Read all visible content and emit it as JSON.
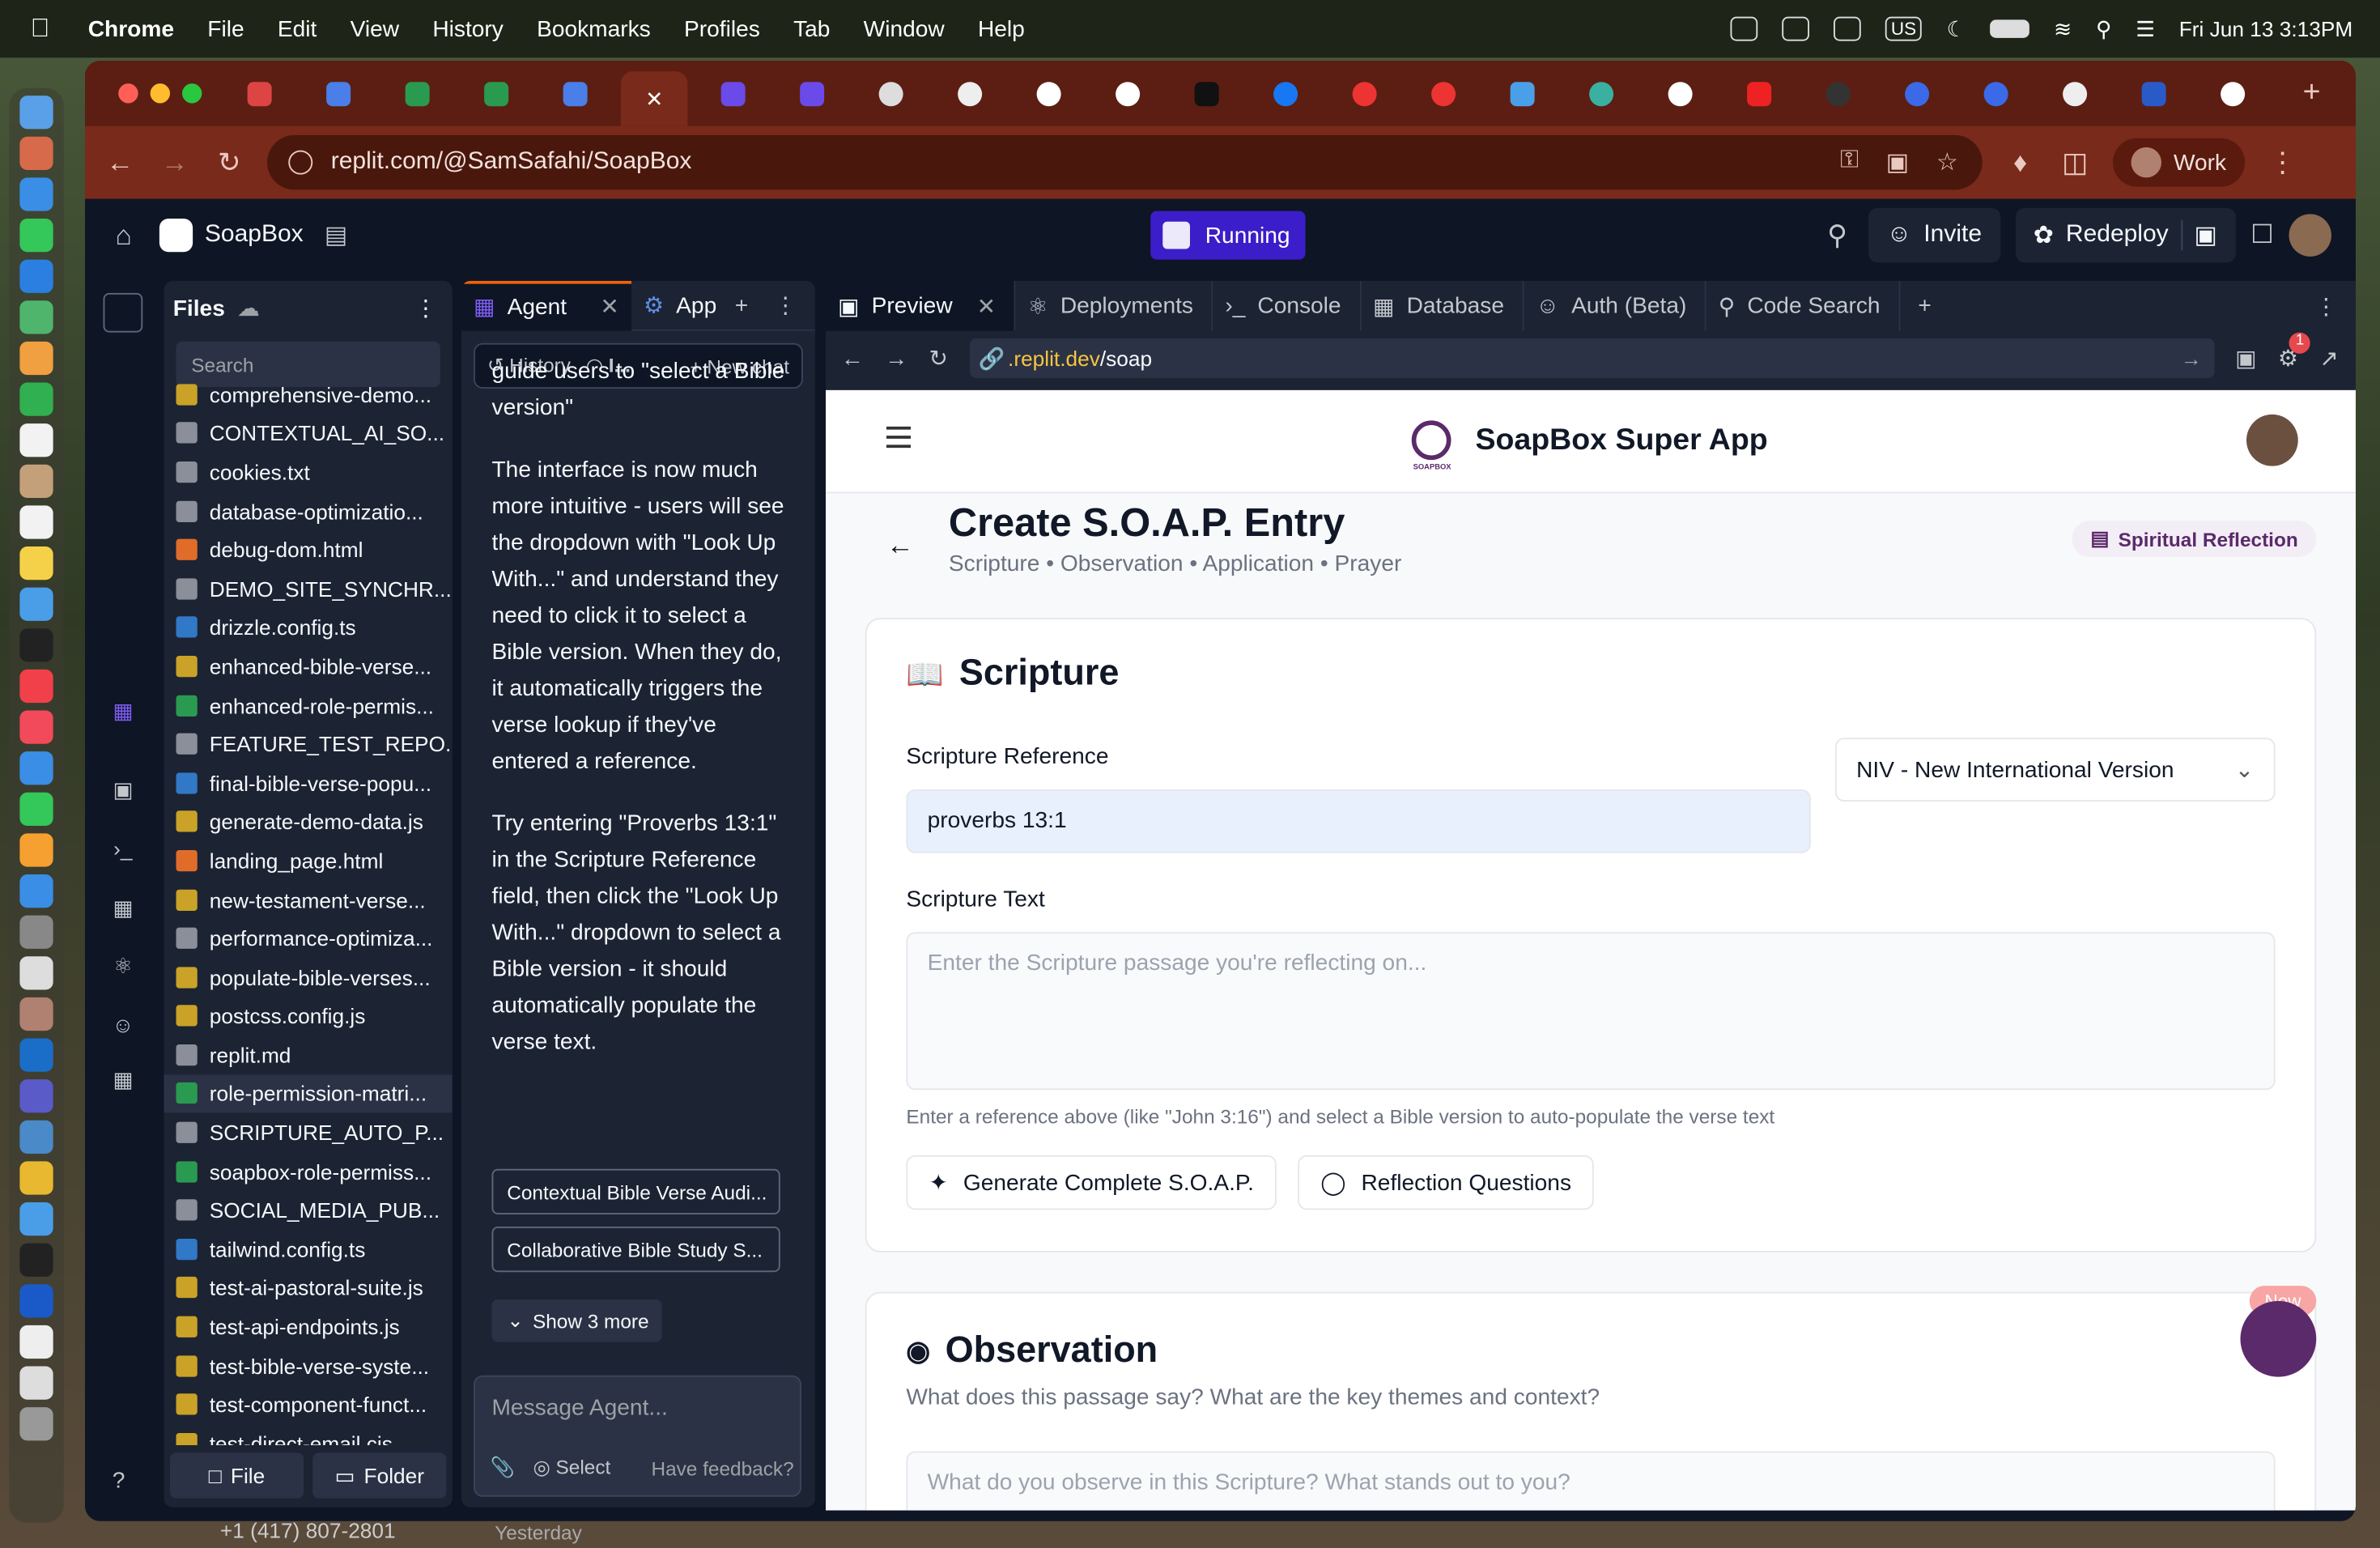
{
  "menubar": {
    "app": "Chrome",
    "items": [
      "File",
      "Edit",
      "View",
      "History",
      "Bookmarks",
      "Profiles",
      "Tab",
      "Window",
      "Help"
    ],
    "input_badge": "US",
    "datetime": "Fri Jun 13  3:13PM"
  },
  "browser": {
    "url": "replit.com/@SamSafahi/SoapBox",
    "profile": "Work"
  },
  "replit": {
    "app_name": "SoapBox",
    "status": "Running",
    "invite": "Invite",
    "redeploy": "Redeploy",
    "help": "?"
  },
  "files": {
    "title": "Files",
    "search_placeholder": "Search",
    "items": [
      {
        "name": "comprehensive-demo...",
        "type": "js"
      },
      {
        "name": "CONTEXTUAL_AI_SO...",
        "type": "md"
      },
      {
        "name": "cookies.txt",
        "type": "txt"
      },
      {
        "name": "database-optimizatio...",
        "type": "db"
      },
      {
        "name": "debug-dom.html",
        "type": "html"
      },
      {
        "name": "DEMO_SITE_SYNCHR...",
        "type": "md"
      },
      {
        "name": "drizzle.config.ts",
        "type": "ts"
      },
      {
        "name": "enhanced-bible-verse...",
        "type": "js"
      },
      {
        "name": "enhanced-role-permis...",
        "type": "csv"
      },
      {
        "name": "FEATURE_TEST_REPO...",
        "type": "md"
      },
      {
        "name": "final-bible-verse-popu...",
        "type": "ts"
      },
      {
        "name": "generate-demo-data.js",
        "type": "js"
      },
      {
        "name": "landing_page.html",
        "type": "html"
      },
      {
        "name": "new-testament-verse...",
        "type": "js"
      },
      {
        "name": "performance-optimiza...",
        "type": "md"
      },
      {
        "name": "populate-bible-verses...",
        "type": "js"
      },
      {
        "name": "postcss.config.js",
        "type": "js"
      },
      {
        "name": "replit.md",
        "type": "md"
      },
      {
        "name": "role-permission-matri...",
        "type": "csv",
        "selected": true
      },
      {
        "name": "SCRIPTURE_AUTO_P...",
        "type": "md"
      },
      {
        "name": "soapbox-role-permiss...",
        "type": "csv"
      },
      {
        "name": "SOCIAL_MEDIA_PUB...",
        "type": "md"
      },
      {
        "name": "tailwind.config.ts",
        "type": "ts"
      },
      {
        "name": "test-ai-pastoral-suite.js",
        "type": "js"
      },
      {
        "name": "test-api-endpoints.js",
        "type": "js"
      },
      {
        "name": "test-bible-verse-syste...",
        "type": "js"
      },
      {
        "name": "test-component-funct...",
        "type": "js"
      },
      {
        "name": "test-direct-email.cjs",
        "type": "js"
      }
    ],
    "new_file": "File",
    "new_folder": "Folder"
  },
  "agent": {
    "tab_agent": "Agent",
    "tab_app": "App",
    "history": "History",
    "status": "I...",
    "new_chat": "New chat",
    "partial_text": "guide users to \"select a Bible version\"",
    "para1": "The interface is now much more intuitive - users will see the dropdown with \"Look Up With...\" and understand they need to click it to select a Bible version. When they do, it automatically triggers the verse lookup if they've entered a reference.",
    "para2": "Try entering \"Proverbs 13:1\" in the Scripture Reference field, then click the \"Look Up With...\" dropdown to select a Bible version - it should automatically populate the verse text.",
    "chips": [
      "Contextual Bible Verse Audi...",
      "Collaborative Bible Study S..."
    ],
    "show_more": "Show 3 more",
    "message_placeholder": "Message Agent...",
    "select": "Select",
    "feedback": "Have feedback?"
  },
  "preview": {
    "tabs": [
      "Preview",
      "Deployments",
      "Console",
      "Database",
      "Auth (Beta)",
      "Code Search"
    ],
    "url_host": ".replit.dev",
    "url_path": "/soap",
    "notif_count": "1"
  },
  "site": {
    "title": "SoapBox Super App",
    "logo_text": "SOAPBOX",
    "page_title": "Create S.O.A.P. Entry",
    "subtitle": "Scripture • Observation • Application • Prayer",
    "badge": "Spiritual Reflection",
    "scripture": {
      "heading": "Scripture",
      "ref_label": "Scripture Reference",
      "ref_value": "proverbs 13:1",
      "version": "NIV - New International Version",
      "text_label": "Scripture Text",
      "text_placeholder": "Enter the Scripture passage you're reflecting on...",
      "hint": "Enter a reference above (like \"John 3:16\") and select a Bible version to auto-populate the verse text",
      "btn_generate": "Generate Complete S.O.A.P.",
      "btn_reflect": "Reflection Questions"
    },
    "observation": {
      "heading": "Observation",
      "desc": "What does this passage say? What are the key themes and context?",
      "placeholder": "What do you observe in this Scripture? What stands out to you?"
    },
    "new_tag": "New"
  },
  "dock_peek": {
    "phone": "+1 (417) 807-2801",
    "when": "Yesterday"
  },
  "colors": {
    "accent": "#f26207",
    "running": "#3b1ec9",
    "brand": "#5b2a6a",
    "tabstrip": "#5c1e12"
  }
}
